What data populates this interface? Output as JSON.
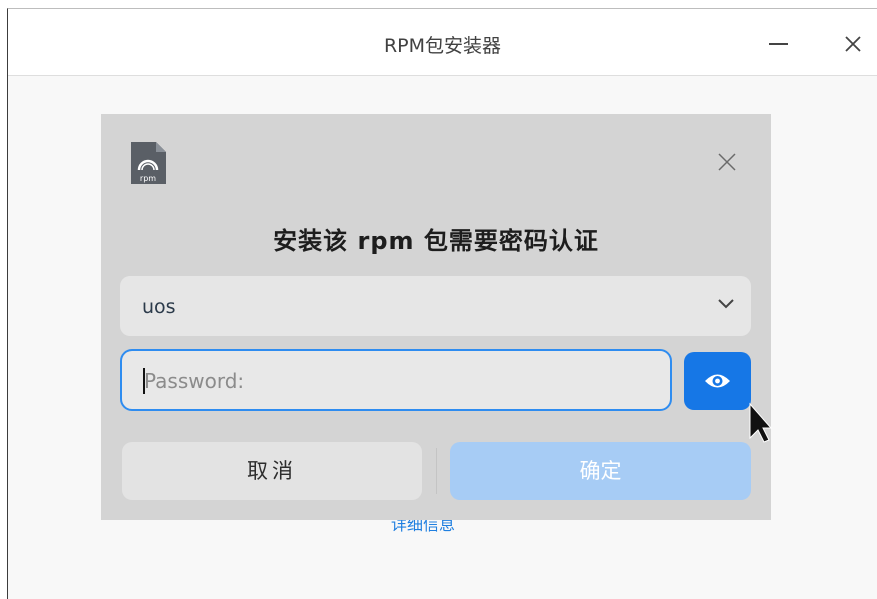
{
  "window": {
    "title": "RPM包安装器",
    "behind_link": "详细信息"
  },
  "dialog": {
    "icon": "rpm-package-icon",
    "icon_label": "rpm",
    "title": "安装该 rpm 包需要密码认证",
    "user_select": {
      "value": "uos"
    },
    "password": {
      "placeholder": "Password:",
      "value": ""
    },
    "buttons": {
      "cancel": "取消",
      "confirm": "确定"
    }
  },
  "colors": {
    "accent": "#1677e6",
    "focus_border": "#2e8cf0",
    "confirm_disabled": "#a7ccf5",
    "dialog_bg": "#d4d4d4"
  }
}
